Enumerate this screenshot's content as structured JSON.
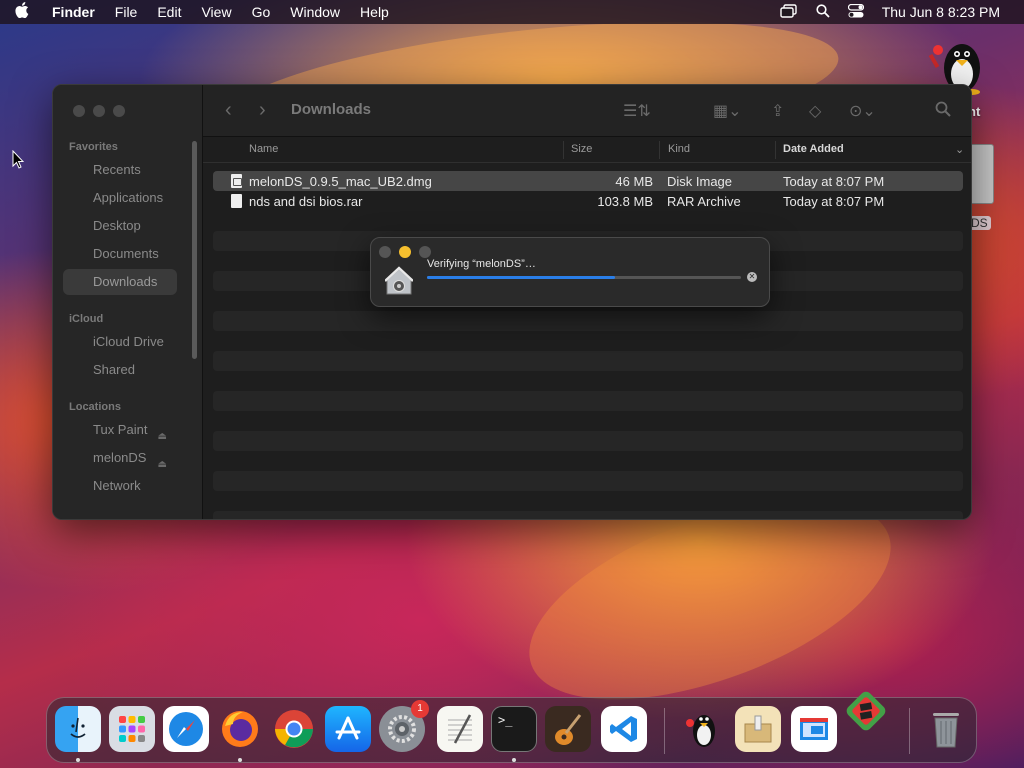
{
  "menubar": {
    "app_name": "Finder",
    "menus": [
      "File",
      "Edit",
      "View",
      "Go",
      "Window",
      "Help"
    ],
    "clock": "Thu Jun 8  8:23 PM"
  },
  "desktop": {
    "tux_label": "nt",
    "drive_label": "DS"
  },
  "finder": {
    "title": "Downloads",
    "sidebar": {
      "favorites_header": "Favorites",
      "favorites": [
        "Recents",
        "Applications",
        "Desktop",
        "Documents",
        "Downloads"
      ],
      "icloud_header": "iCloud",
      "icloud": [
        "iCloud Drive",
        "Shared"
      ],
      "locations_header": "Locations",
      "locations": [
        "Tux Paint",
        "melonDS",
        "Network"
      ]
    },
    "columns": {
      "name": "Name",
      "size": "Size",
      "kind": "Kind",
      "date": "Date Added"
    },
    "files": [
      {
        "name": "melonDS_0.9.5_mac_UB2.dmg",
        "size": "46 MB",
        "kind": "Disk Image",
        "date": "Today at 8:07 PM"
      },
      {
        "name": "nds and dsi bios.rar",
        "size": "103.8 MB",
        "kind": "RAR Archive",
        "date": "Today at 8:07 PM"
      }
    ]
  },
  "dialog": {
    "message": "Verifying “melonDS”…",
    "progress": 0.6
  },
  "dock": {
    "settings_badge": "1"
  },
  "colors": {
    "accent": "#2a7ee8",
    "minimize": "#f5bf2e",
    "badge": "#e53935"
  }
}
